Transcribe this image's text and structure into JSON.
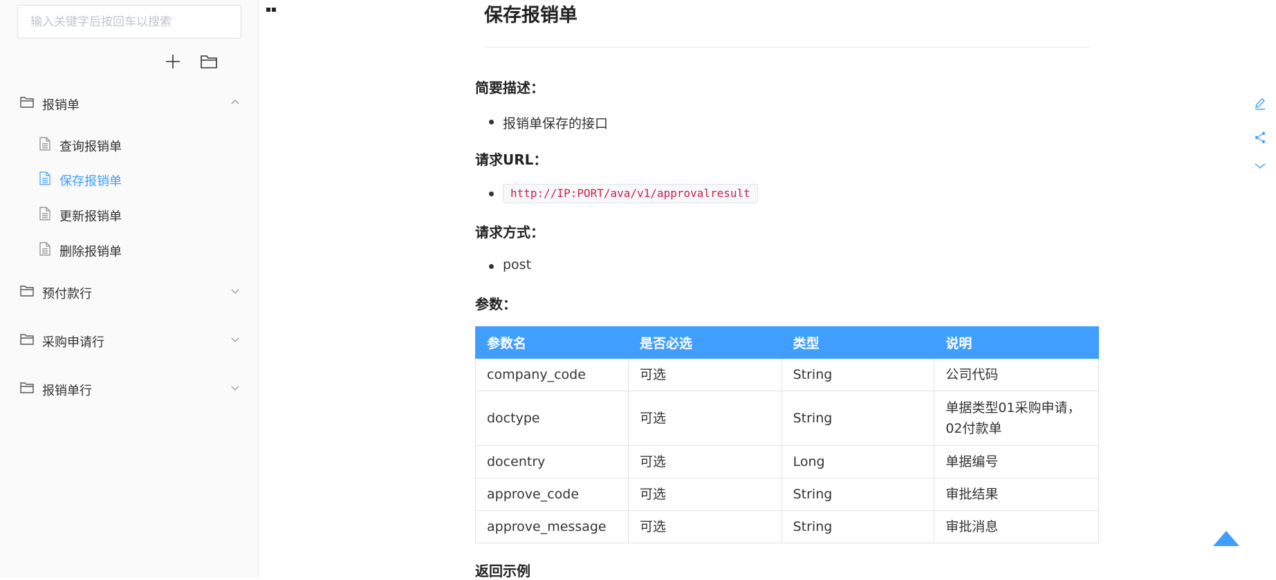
{
  "sidebar": {
    "search": {
      "placeholder": "输入关键字后按回车以搜索",
      "value": ""
    },
    "tree": [
      {
        "label": "报销单",
        "expanded": true,
        "children": [
          {
            "label": "查询报销单",
            "active": false
          },
          {
            "label": "保存报销单",
            "active": true
          },
          {
            "label": "更新报销单",
            "active": false
          },
          {
            "label": "删除报销单",
            "active": false
          }
        ]
      },
      {
        "label": "预付款行",
        "expanded": false
      },
      {
        "label": "采购申请行",
        "expanded": false
      },
      {
        "label": "报销单行",
        "expanded": false
      }
    ]
  },
  "page": {
    "title": "保存报销单",
    "sections": {
      "desc_heading": "简要描述：",
      "desc_item": "报销单保存的接口",
      "url_heading": "请求URL：",
      "url_value": "http://IP:PORT/ava/v1/approvalresult",
      "method_heading": "请求方式：",
      "method_value": "post",
      "params_heading": "参数：",
      "return_heading": "返回示例"
    },
    "params_table": {
      "headers": [
        "参数名",
        "是否必选",
        "类型",
        "说明"
      ],
      "rows": [
        [
          "company_code",
          "可选",
          "String",
          "公司代码"
        ],
        [
          "doctype",
          "可选",
          "String",
          "单据类型01采购申请，02付款单"
        ],
        [
          "docentry",
          "可选",
          "Long",
          "单据编号"
        ],
        [
          "approve_code",
          "可选",
          "String",
          "审批结果"
        ],
        [
          "approve_message",
          "可选",
          "String",
          "审批消息"
        ]
      ]
    }
  },
  "colors": {
    "accent": "#409eff",
    "code": "#c7254e"
  },
  "icons": {
    "toolbar": [
      "plus-icon",
      "folder-icon"
    ],
    "right_tools": [
      "edit-icon",
      "share-icon",
      "chevron-down-icon"
    ],
    "back_to_top": "triangle-up-icon"
  }
}
